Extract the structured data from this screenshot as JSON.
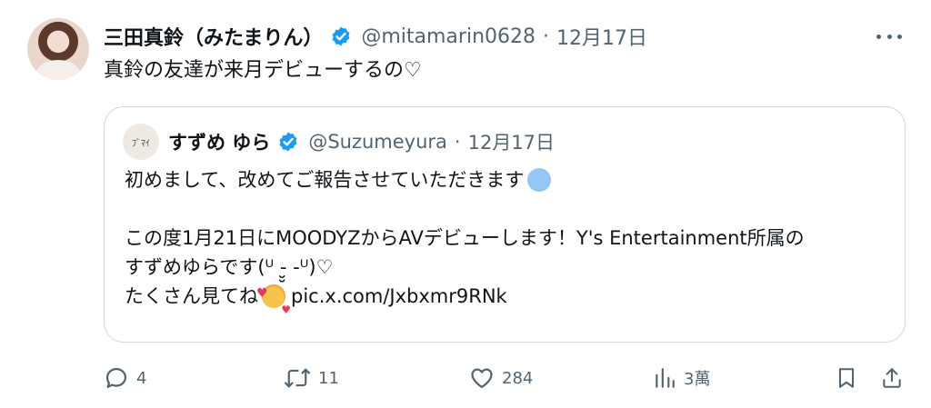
{
  "author": {
    "name": "三田真鈴（みたまりん）",
    "handle": "@mitamarin0628",
    "separator": "·",
    "date": "12月17日"
  },
  "tweet_text": "真鈴の友達が来月デビューするの♡",
  "quote": {
    "avatar_text": "ﾌﾞﾏｲ",
    "name": "すずめ ゆら",
    "handle": "@Suzumeyura",
    "separator": "·",
    "date": "12月17日",
    "lines": {
      "l1": "初めまして、改めてご報告させていただきます",
      "l2": "この度1月21日にMOODYZからAVデビューします！Y's Entertainment所属の",
      "l3": "すずめゆらです(ᵁ -̮̮ -ᵁ)♡",
      "l4": "たくさん見てね",
      "l4_link": "pic.x.com/Jxbxmr9RNk"
    },
    "emoji": {
      "heart": "light-blue-heart-emoji",
      "smile": "smiling-face-with-hearts-emoji"
    }
  },
  "actions": {
    "reply": {
      "icon": "reply-icon",
      "count": "4"
    },
    "retweet": {
      "icon": "retweet-icon",
      "count": "11"
    },
    "like": {
      "icon": "heart-icon",
      "count": "284"
    },
    "views": {
      "icon": "views-icon",
      "count": "3萬"
    },
    "bookmark": {
      "icon": "bookmark-icon"
    },
    "share": {
      "icon": "share-icon"
    }
  },
  "colors": {
    "verified": "#1d9bf0",
    "secondary": "#536471",
    "border": "#cfd9de"
  }
}
